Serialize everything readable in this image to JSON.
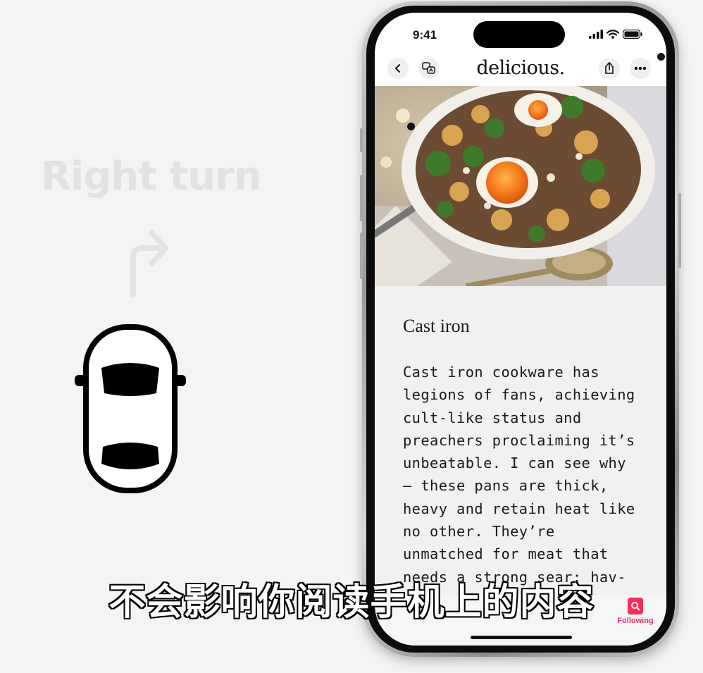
{
  "motion_cue": {
    "label": "Right turn",
    "arrow_icon": "turn-right-arrow-icon",
    "vehicle_icon": "car-top-view-icon"
  },
  "status_bar": {
    "time": "9:41",
    "icons": [
      "cellular-signal-icon",
      "wifi-icon",
      "battery-icon"
    ]
  },
  "nav_bar": {
    "brand": "delicious.",
    "buttons": [
      "back-icon",
      "translate-icon",
      "share-icon",
      "more-icon"
    ]
  },
  "hero_image": {
    "subject": "skillet hash with potatoes, kale and eggs"
  },
  "article": {
    "title": "Cast iron",
    "body_lines": [
      "Cast iron cookware has",
      "legions of fans, achieving",
      "cult-like status and",
      "preachers proclaiming it’s",
      "unbeatable. I can see why",
      "– these pans are thick,",
      "heavy and retain heat like",
      "no other. They’re",
      "unmatched for meat that",
      "needs a strong sear: hav-"
    ]
  },
  "tab_bar": {
    "following_label": "Following",
    "following_icon": "search-newspaper-icon"
  },
  "subtitle_caption": "不会影响你阅读手机上的内容",
  "colors": {
    "background": "#f4f4f4",
    "accent": "#f0315a",
    "faded_cue": "#e2e2e2"
  }
}
